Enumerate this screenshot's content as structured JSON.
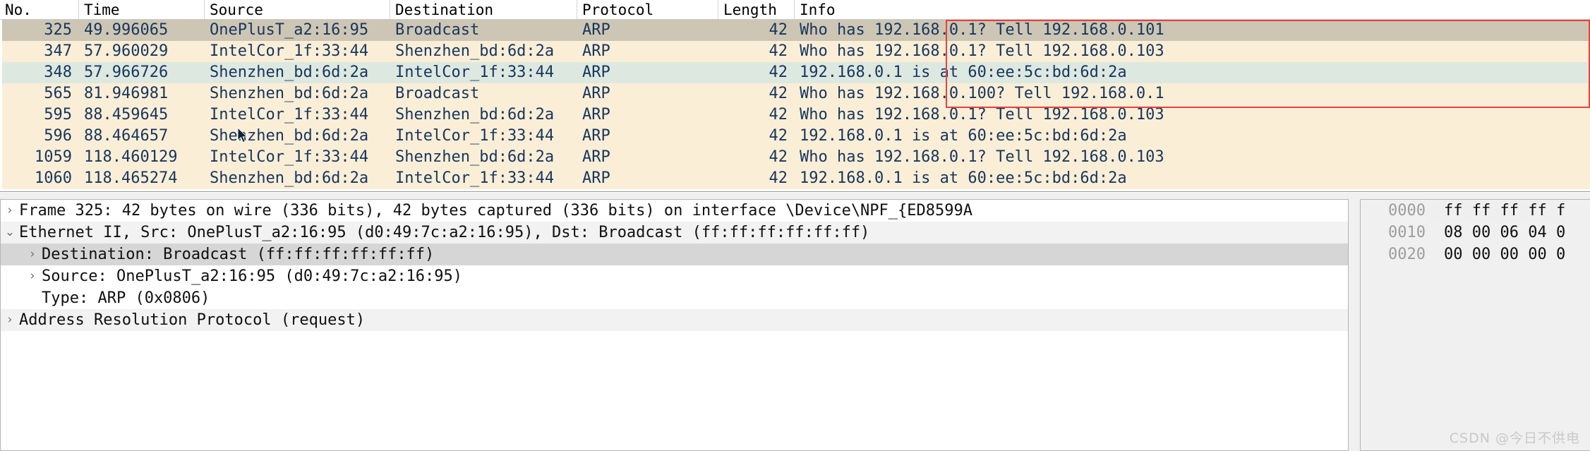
{
  "packet_list": {
    "columns": [
      {
        "key": "no",
        "label": "No."
      },
      {
        "key": "time",
        "label": "Time"
      },
      {
        "key": "source",
        "label": "Source"
      },
      {
        "key": "destination",
        "label": "Destination"
      },
      {
        "key": "protocol",
        "label": "Protocol"
      },
      {
        "key": "length",
        "label": "Length"
      },
      {
        "key": "info",
        "label": "Info"
      }
    ],
    "rows": [
      {
        "no": "325",
        "time": "49.996065",
        "source": "OnePlusT_a2:16:95",
        "destination": "Broadcast",
        "protocol": "ARP",
        "length": "42",
        "info": "Who has 192.168.0.1? Tell 192.168.0.101",
        "style": "selected"
      },
      {
        "no": "347",
        "time": "57.960029",
        "source": "IntelCor_1f:33:44",
        "destination": "Shenzhen_bd:6d:2a",
        "protocol": "ARP",
        "length": "42",
        "info": "Who has 192.168.0.1? Tell 192.168.0.103",
        "style": "normal"
      },
      {
        "no": "348",
        "time": "57.966726",
        "source": "Shenzhen_bd:6d:2a",
        "destination": "IntelCor_1f:33:44",
        "protocol": "ARP",
        "length": "42",
        "info": "192.168.0.1 is at 60:ee:5c:bd:6d:2a",
        "style": "reply"
      },
      {
        "no": "565",
        "time": "81.946981",
        "source": "Shenzhen_bd:6d:2a",
        "destination": "Broadcast",
        "protocol": "ARP",
        "length": "42",
        "info": "Who has 192.168.0.100? Tell 192.168.0.1",
        "style": "normal"
      },
      {
        "no": "595",
        "time": "88.459645",
        "source": "IntelCor_1f:33:44",
        "destination": "Shenzhen_bd:6d:2a",
        "protocol": "ARP",
        "length": "42",
        "info": "Who has 192.168.0.1? Tell 192.168.0.103",
        "style": "normal"
      },
      {
        "no": "596",
        "time": "88.464657",
        "source": "Shenzhen_bd:6d:2a",
        "destination": "IntelCor_1f:33:44",
        "protocol": "ARP",
        "length": "42",
        "info": "192.168.0.1 is at 60:ee:5c:bd:6d:2a",
        "style": "normal"
      },
      {
        "no": "1059",
        "time": "118.460129",
        "source": "IntelCor_1f:33:44",
        "destination": "Shenzhen_bd:6d:2a",
        "protocol": "ARP",
        "length": "42",
        "info": "Who has 192.168.0.1? Tell 192.168.0.103",
        "style": "normal"
      },
      {
        "no": "1060",
        "time": "118.465274",
        "source": "Shenzhen_bd:6d:2a",
        "destination": "IntelCor_1f:33:44",
        "protocol": "ARP",
        "length": "42",
        "info": "192.168.0.1 is at 60:ee:5c:bd:6d:2a",
        "style": "normal"
      }
    ],
    "annotation_color": "#e8413c"
  },
  "detail_tree": {
    "rows": [
      {
        "twisty": "›",
        "indent": 1,
        "text": "Frame 325: 42 bytes on wire (336 bits), 42 bytes captured (336 bits) on interface \\Device\\NPF_{ED8599A",
        "highlight": "none"
      },
      {
        "twisty": "⌄",
        "indent": 1,
        "text": "Ethernet II, Src: OnePlusT_a2:16:95 (d0:49:7c:a2:16:95), Dst: Broadcast (ff:ff:ff:ff:ff:ff)",
        "highlight": "light"
      },
      {
        "twisty": "›",
        "indent": 2,
        "text": "Destination: Broadcast (ff:ff:ff:ff:ff:ff)",
        "highlight": "gray"
      },
      {
        "twisty": "›",
        "indent": 2,
        "text": "Source: OnePlusT_a2:16:95 (d0:49:7c:a2:16:95)",
        "highlight": "none"
      },
      {
        "twisty": "",
        "indent": 3,
        "text": "Type: ARP (0x0806)",
        "highlight": "none"
      },
      {
        "twisty": "›",
        "indent": 1,
        "text": "Address Resolution Protocol (request)",
        "highlight": "light"
      }
    ]
  },
  "hex_pane": {
    "rows": [
      {
        "offset": "0000",
        "bytes": "ff ff ff ff f"
      },
      {
        "offset": "0010",
        "bytes": "08 00 06 04 0"
      },
      {
        "offset": "0020",
        "bytes": "00 00 00 00 0"
      }
    ]
  },
  "watermark": {
    "text": "CSDN @今日不供电"
  }
}
